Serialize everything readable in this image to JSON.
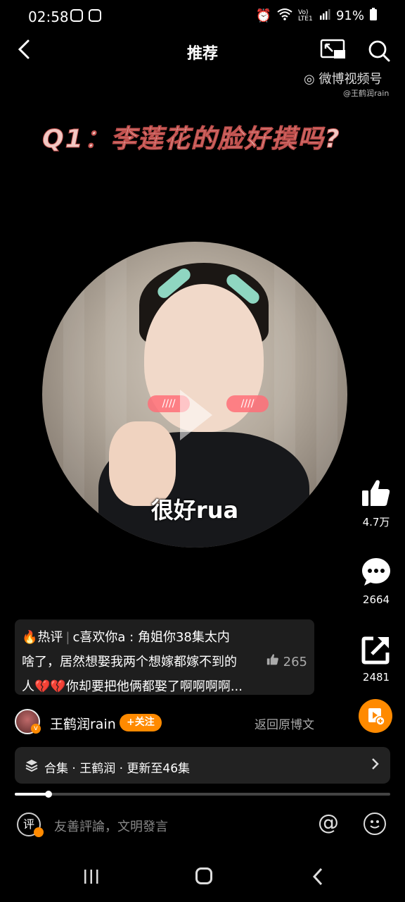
{
  "status_bar": {
    "time": "02:58",
    "network_label": "Vo) LTE1",
    "battery": "91%"
  },
  "header": {
    "title": "推荐"
  },
  "watermark": {
    "brand": "微博视频号",
    "user": "@王鹤润rain"
  },
  "video": {
    "overlay_title": "Q1：李莲花的脸好摸吗?",
    "subtitle": "很好rua",
    "blush_text_left": "////",
    "blush_text_right": "////"
  },
  "actions": {
    "like_count": "4.7万",
    "comment_count": "2664",
    "share_count": "2481"
  },
  "hot_comment": {
    "tag": "热评",
    "user": "c喜欢你a",
    "text_line1": "角姐你38集太内",
    "text_line2": "啥了，居然想娶我两个想嫁都嫁不到的",
    "text_line3": "人💔💔你却要把他俩都娶了啊啊啊啊...",
    "likes": "265"
  },
  "author": {
    "name": "王鹤润rain",
    "follow_label": "+关注",
    "back_label": "返回原博文"
  },
  "collection": {
    "text": "合集 · 王鹤润 · 更新至46集"
  },
  "progress": {
    "fraction": 0.09
  },
  "comment_bar": {
    "icon_text": "评",
    "placeholder": "友善評論，文明發言"
  },
  "accent_color": "#ff8a00"
}
